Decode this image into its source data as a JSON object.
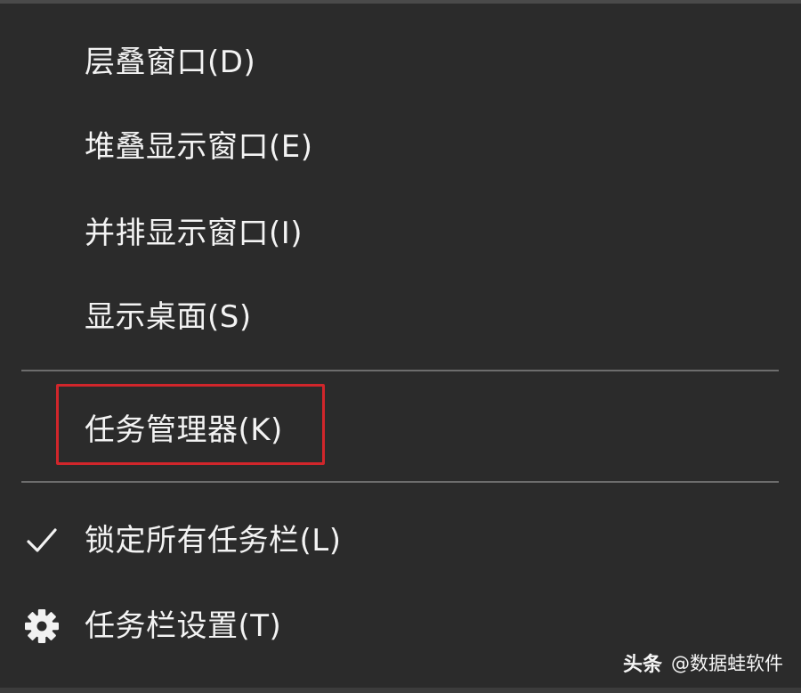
{
  "menu": {
    "items": [
      {
        "label": "层叠窗口(D)"
      },
      {
        "label": "堆叠显示窗口(E)"
      },
      {
        "label": "并排显示窗口(I)"
      },
      {
        "label": "显示桌面(S)"
      },
      {
        "label": "任务管理器(K)"
      },
      {
        "label": "锁定所有任务栏(L)",
        "checked": true
      },
      {
        "label": "任务栏设置(T)",
        "icon": "gear-icon"
      }
    ]
  },
  "watermark": {
    "brand": "头条",
    "account": "@数据蛙软件"
  },
  "colors": {
    "menu_background": "#2b2b2b",
    "separator": "#6d6d6d",
    "highlight_border": "#d1262b",
    "text": "#f3f3f3"
  }
}
